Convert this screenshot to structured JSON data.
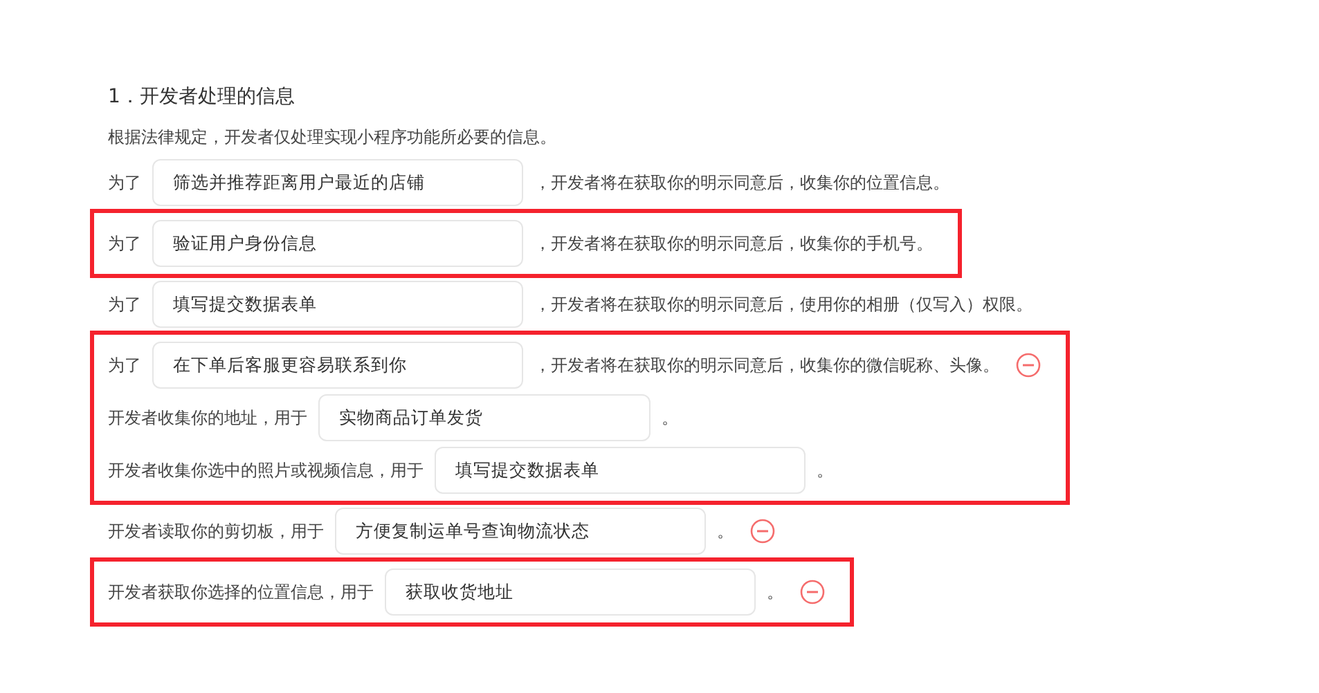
{
  "section_title": "1．开发者处理的信息",
  "intro": "根据法律规定，开发者仅处理实现小程序功能所必要的信息。",
  "blocks": [
    {
      "highlighted": false,
      "rows": [
        {
          "kind": "purpose",
          "prefix": "为了",
          "value": "筛选并推荐距离用户最近的店铺",
          "suffix": "，开发者将在获取你的明示同意后，收集你的位置信息。",
          "removable": false
        }
      ]
    },
    {
      "highlighted": true,
      "rows": [
        {
          "kind": "purpose",
          "prefix": "为了",
          "value": "验证用户身份信息",
          "suffix": "，开发者将在获取你的明示同意后，收集你的手机号。",
          "removable": false
        }
      ]
    },
    {
      "highlighted": false,
      "rows": [
        {
          "kind": "purpose",
          "prefix": "为了",
          "value": "填写提交数据表单",
          "suffix": "，开发者将在获取你的明示同意后，使用你的相册（仅写入）权限。",
          "removable": false
        }
      ]
    },
    {
      "highlighted": true,
      "rows": [
        {
          "kind": "purpose",
          "prefix": "为了",
          "value": "在下单后客服更容易联系到你",
          "suffix": "，开发者将在获取你的明示同意后，收集你的微信昵称、头像。",
          "removable": true
        },
        {
          "kind": "usage",
          "prefix": "开发者收集你的地址，用于",
          "value": "实物商品订单发货",
          "suffix": "。",
          "removable": false
        },
        {
          "kind": "usage",
          "prefix": "开发者收集你选中的照片或视频信息，用于",
          "value": "填写提交数据表单",
          "suffix": "。",
          "removable": false
        }
      ]
    },
    {
      "highlighted": false,
      "rows": [
        {
          "kind": "usage",
          "prefix": "开发者读取你的剪切板，用于",
          "value": "方便复制运单号查询物流状态",
          "suffix": "。",
          "removable": true
        }
      ]
    },
    {
      "highlighted": true,
      "rows": [
        {
          "kind": "usage",
          "prefix": "开发者获取你选择的位置信息，用于",
          "value": "获取收货地址",
          "suffix": "。",
          "removable": true
        }
      ]
    }
  ]
}
